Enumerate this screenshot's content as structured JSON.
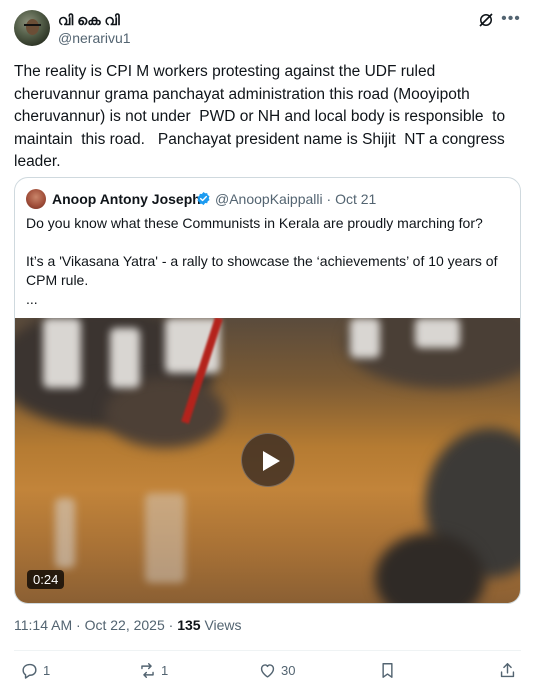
{
  "author": {
    "display_name": "വി കെ വി",
    "handle": "@nerarivu1"
  },
  "tweet": {
    "text": "The reality is CPI M workers protesting against the UDF ruled cheruvannur grama panchayat administration this road (Mooyipoth cheruvannur) is not under  PWD or NH and local body is responsible  to maintain  this road.   Panchayat president name is Shijit  NT a congress leader."
  },
  "quoted_tweet": {
    "display_name": "Anoop Antony Joseph",
    "handle": "@AnoopKaippalli",
    "separator": "·",
    "date": "Oct 21",
    "text": "Do you know what these Communists in Kerala are proudly marching for?\n\nIt’s a 'Vikasana Yatra' - a rally to showcase the ‘achievements’ of 10 years of CPM rule.\n...",
    "video_duration": "0:24"
  },
  "meta": {
    "time": "11:14 AM",
    "separator": "·",
    "date": "Oct 22, 2025",
    "views_dot": "·",
    "views_count": "135",
    "views_label": "Views"
  },
  "actions": {
    "replies": "1",
    "reposts": "1",
    "likes": "30"
  },
  "icons": {
    "grok": "grok-icon",
    "more": "more-icon",
    "verified": "verified-badge-icon",
    "reply": "reply-icon",
    "repost": "repost-icon",
    "like": "heart-icon",
    "bookmark": "bookmark-icon",
    "share": "share-icon",
    "play": "play-icon"
  },
  "colors": {
    "text": "#0f1419",
    "secondary": "#536471",
    "border": "#cfd9de",
    "verified": "#1d9bf0"
  }
}
